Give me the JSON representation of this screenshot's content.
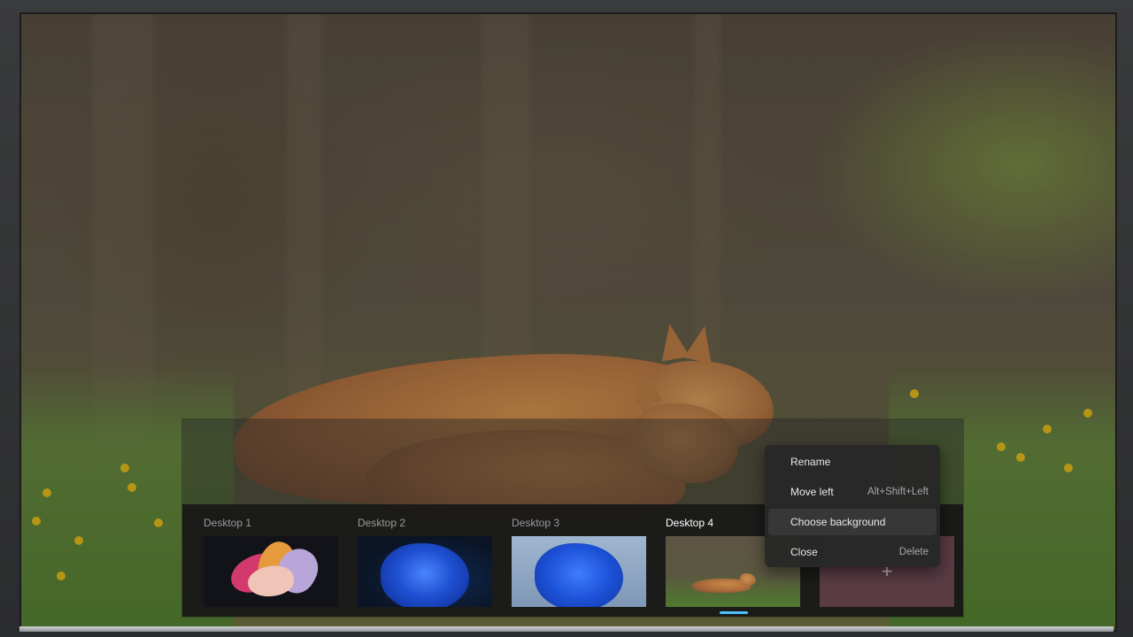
{
  "task_view": {
    "desktops": [
      {
        "label": "Desktop 1",
        "active": false,
        "wallpaper": "windows-11-bloom-colorful"
      },
      {
        "label": "Desktop 2",
        "active": false,
        "wallpaper": "windows-11-bloom-dark-blue"
      },
      {
        "label": "Desktop 3",
        "active": false,
        "wallpaper": "windows-11-bloom-light-blue"
      },
      {
        "label": "Desktop 4",
        "active": true,
        "wallpaper": "fox-meadow"
      }
    ],
    "new_desktop_icon": "+",
    "active_indicator_color": "#4cc2ff"
  },
  "context_menu": {
    "items": [
      {
        "label": "Rename",
        "shortcut": ""
      },
      {
        "label": "Move left",
        "shortcut": "Alt+Shift+Left"
      },
      {
        "label": "Choose background",
        "shortcut": "",
        "highlighted": true
      },
      {
        "label": "Close",
        "shortcut": "Delete"
      }
    ]
  },
  "colors": {
    "accent": "#4cc2ff",
    "new_desktop_tile": "#5a3b44",
    "menu_background": "#282828"
  }
}
